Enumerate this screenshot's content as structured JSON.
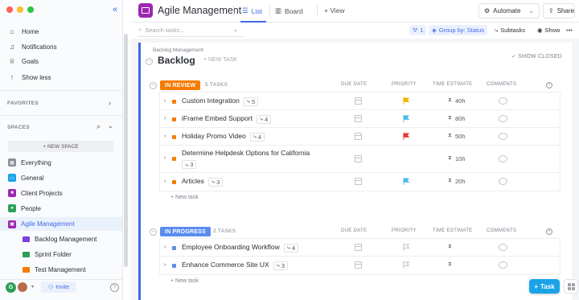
{
  "window": {
    "traffic_colors": [
      "#ff5f57",
      "#febc2e",
      "#28c840"
    ]
  },
  "sidebar": {
    "nav": [
      {
        "label": "Home",
        "icon": "home-icon"
      },
      {
        "label": "Notifications",
        "icon": "bell-icon"
      },
      {
        "label": "Goals",
        "icon": "trophy-icon"
      },
      {
        "label": "Show less",
        "icon": "arrow-up-icon"
      }
    ],
    "favorites_label": "FAVORITES",
    "spaces_label": "SPACES",
    "new_space_label": "+ NEW SPACE",
    "spaces": [
      {
        "label": "Everything",
        "icon": "grid-icon",
        "color": "#8a8f98"
      },
      {
        "label": "General",
        "icon": "laptop-icon",
        "color": "#1aa3e8"
      },
      {
        "label": "Client Projects",
        "icon": "folder-icon",
        "color": "#9c27b0"
      },
      {
        "label": "People",
        "icon": "person-icon",
        "color": "#2e9e5b"
      },
      {
        "label": "Agile Management",
        "icon": "board-icon",
        "color": "#9c27b0"
      }
    ],
    "folders": [
      {
        "label": "Backlog Management",
        "color": "#7b3fe4"
      },
      {
        "label": "Sprint Folder",
        "color": "#2e9e5b"
      },
      {
        "label": "Test Management",
        "color": "#f57c00"
      }
    ],
    "avatar_letter": "G",
    "invite_label": "Invite",
    "help_label": "?"
  },
  "header": {
    "title": "Agile Management",
    "tabs": [
      {
        "label": "List",
        "icon": "list-icon"
      },
      {
        "label": "Board",
        "icon": "board-icon"
      }
    ],
    "add_view_label": "+ View",
    "automate_label": "Automate",
    "share_label": "Share"
  },
  "toolbar": {
    "search_placeholder": "Search tasks...",
    "filter_count": "1",
    "group_by_label": "Group by: Status",
    "subtasks_label": "Subtasks",
    "show_label": "Show"
  },
  "list": {
    "breadcrumb": "Backlog Management",
    "title": "Backlog",
    "new_task_header": "+ NEW TASK",
    "show_closed": "SHOW CLOSED",
    "columns": [
      "DUE DATE",
      "PRIORITY",
      "TIME ESTIMATE",
      "COMMENTS"
    ],
    "groups": [
      {
        "status": "IN REVIEW",
        "color": "#f57c00",
        "count": "5 TASKS",
        "tasks": [
          {
            "name": "Custom Integration",
            "subtasks": "5",
            "flag": "#f5b400",
            "estimate": "40h"
          },
          {
            "name": "iFrame Embed Support",
            "subtasks": "4",
            "flag": "#4fb8ec",
            "estimate": "80h"
          },
          {
            "name": "Holiday Promo Video",
            "subtasks": "4",
            "flag": "#e53935",
            "estimate": "50h"
          },
          {
            "name": "Determine Helpdesk Options for California",
            "subtasks": "3",
            "flag": "",
            "estimate": "10h"
          },
          {
            "name": "Articles",
            "subtasks": "3",
            "flag": "#4fb8ec",
            "estimate": "20h"
          }
        ],
        "new_task": "+ New task"
      },
      {
        "status": "IN PROGRESS",
        "color": "#5b8def",
        "count": "2 TASKS",
        "tasks": [
          {
            "name": "Employee Onboarding Workflow",
            "subtasks": "4",
            "flag": "none",
            "estimate": ""
          },
          {
            "name": "Enhance Commerce Site UX",
            "subtasks": "3",
            "flag": "none",
            "estimate": ""
          }
        ],
        "new_task": "+ New task"
      }
    ]
  },
  "fab": {
    "label": "Task"
  }
}
